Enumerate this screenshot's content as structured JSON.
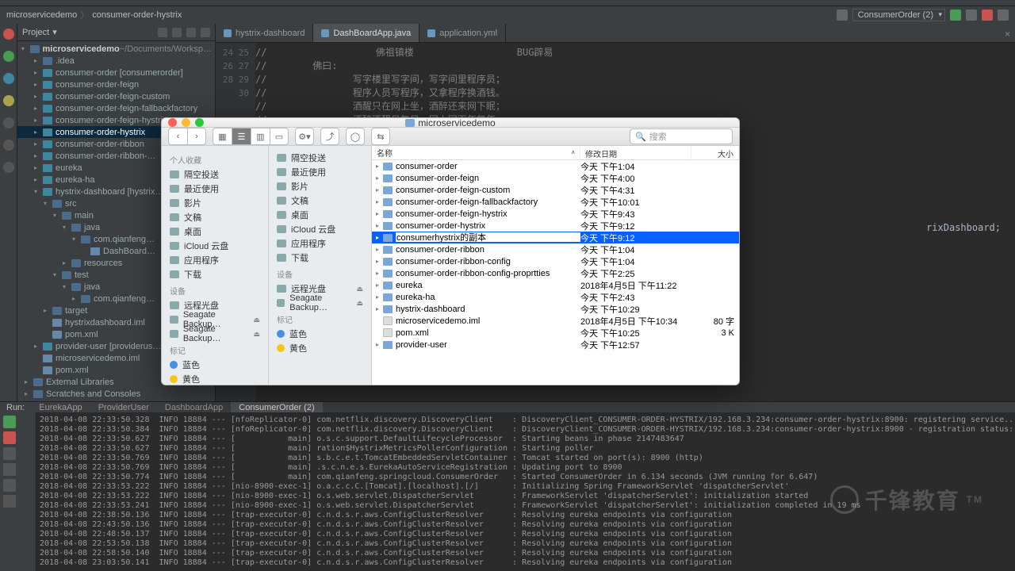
{
  "breadcrumb": {
    "a": "microservicedemo",
    "b": "consumer-order-hystrix"
  },
  "run_config": "ConsumerOrder (2)",
  "project": {
    "title": "Project",
    "root": "microservicedemo",
    "root_hint": "~/Documents/Worksp…",
    "items": [
      {
        "depth": 1,
        "arrow": "▸",
        "icon": "folder",
        "label": ".idea"
      },
      {
        "depth": 1,
        "arrow": "▸",
        "icon": "module",
        "label": "consumer-order [consumerorder]"
      },
      {
        "depth": 1,
        "arrow": "▸",
        "icon": "module",
        "label": "consumer-order-feign"
      },
      {
        "depth": 1,
        "arrow": "▸",
        "icon": "module",
        "label": "consumer-order-feign-custom"
      },
      {
        "depth": 1,
        "arrow": "▸",
        "icon": "module",
        "label": "consumer-order-feign-fallbackfactory"
      },
      {
        "depth": 1,
        "arrow": "▸",
        "icon": "module",
        "label": "consumer-order-feign-hystrix"
      },
      {
        "depth": 1,
        "arrow": "▸",
        "icon": "module",
        "label": "consumer-order-hystrix",
        "sel": true
      },
      {
        "depth": 1,
        "arrow": "▸",
        "icon": "module",
        "label": "consumer-order-ribbon"
      },
      {
        "depth": 1,
        "arrow": "▸",
        "icon": "module",
        "label": "consumer-order-ribbon-…"
      },
      {
        "depth": 1,
        "arrow": "▸",
        "icon": "module",
        "label": "eureka"
      },
      {
        "depth": 1,
        "arrow": "▸",
        "icon": "module",
        "label": "eureka-ha"
      },
      {
        "depth": 1,
        "arrow": "▾",
        "icon": "module",
        "label": "hystrix-dashboard [hystrix…"
      },
      {
        "depth": 2,
        "arrow": "▾",
        "icon": "folder",
        "label": "src"
      },
      {
        "depth": 3,
        "arrow": "▾",
        "icon": "folder",
        "label": "main"
      },
      {
        "depth": 4,
        "arrow": "▾",
        "icon": "folder",
        "label": "java"
      },
      {
        "depth": 5,
        "arrow": "▾",
        "icon": "folder",
        "label": "com.qianfeng…"
      },
      {
        "depth": 6,
        "arrow": " ",
        "icon": "file",
        "label": "DashBoard…"
      },
      {
        "depth": 4,
        "arrow": "▸",
        "icon": "folder",
        "label": "resources"
      },
      {
        "depth": 3,
        "arrow": "▾",
        "icon": "folder",
        "label": "test"
      },
      {
        "depth": 4,
        "arrow": "▾",
        "icon": "folder",
        "label": "java"
      },
      {
        "depth": 5,
        "arrow": "▸",
        "icon": "folder",
        "label": "com.qianfeng…"
      },
      {
        "depth": 2,
        "arrow": "▸",
        "icon": "folder",
        "label": "target"
      },
      {
        "depth": 2,
        "arrow": " ",
        "icon": "file",
        "label": "hystrixdashboard.iml"
      },
      {
        "depth": 2,
        "arrow": " ",
        "icon": "file",
        "label": "pom.xml"
      },
      {
        "depth": 1,
        "arrow": "▸",
        "icon": "module",
        "label": "provider-user [providerus…"
      },
      {
        "depth": 1,
        "arrow": " ",
        "icon": "file",
        "label": "microservicedemo.iml"
      },
      {
        "depth": 1,
        "arrow": " ",
        "icon": "file",
        "label": "pom.xml"
      },
      {
        "depth": 0,
        "arrow": "▸",
        "icon": "folder",
        "label": "External Libraries"
      },
      {
        "depth": 0,
        "arrow": "▸",
        "icon": "folder",
        "label": "Scratches and Consoles"
      }
    ]
  },
  "tabs": [
    {
      "label": "hystrix-dashboard"
    },
    {
      "label": "DashBoardApp.java",
      "active": true
    },
    {
      "label": "application.yml"
    }
  ],
  "gutter_start": 24,
  "code_lines": [
    "//                   佛祖镇楼                  BUG辟易",
    "//        佛曰:",
    "//               写字楼里写字间，写字间里程序员；",
    "//               程序人员写程序，又拿程序换酒钱。",
    "//               酒醒只在网上坐，酒醉还来网下眠；",
    "//               酒醉酒醒日复日，网上网下年复年。",
    "//"
  ],
  "import_fragment": "rixDashboard;",
  "run": {
    "label": "Run:",
    "tabs": [
      "EurekaApp",
      "ProviderUser",
      "DashboardApp",
      "ConsumerOrder (2)"
    ],
    "active_tab": 3,
    "lines": [
      "2018-04-08 22:33:50.328  INFO 18884 --- [nfoReplicator-0] com.netflix.discovery.DiscoveryClient    : DiscoveryClient_CONSUMER-ORDER-HYSTRIX/192.168.3.234:consumer-order-hystrix:8900: registering service...",
      "2018-04-08 22:33:50.384  INFO 18884 --- [nfoReplicator-0] com.netflix.discovery.DiscoveryClient    : DiscoveryClient_CONSUMER-ORDER-HYSTRIX/192.168.3.234:consumer-order-hystrix:8900 - registration status: 204",
      "2018-04-08 22:33:50.627  INFO 18884 --- [           main] o.s.c.support.DefaultLifecycleProcessor  : Starting beans in phase 2147483647",
      "2018-04-08 22:33:50.627  INFO 18884 --- [           main] ration$HystrixMetricsPollerConfiguration : Starting poller",
      "2018-04-08 22:33:50.769  INFO 18884 --- [           main] s.b.c.e.t.TomcatEmbeddedServletContainer : Tomcat started on port(s): 8900 (http)",
      "2018-04-08 22:33:50.769  INFO 18884 --- [           main] .s.c.n.e.s.EurekaAutoServiceRegistration : Updating port to 8900",
      "2018-04-08 22:33:50.774  INFO 18884 --- [           main] com.qianfeng.springcloud.ConsumerOrder   : Started ConsumerOrder in 6.134 seconds (JVM running for 6.647)",
      "2018-04-08 22:33:53.222  INFO 18884 --- [nio-8900-exec-1] o.a.c.c.C.[Tomcat].[localhost].[/]       : Initializing Spring FrameworkServlet 'dispatcherServlet'",
      "2018-04-08 22:33:53.222  INFO 18884 --- [nio-8900-exec-1] o.s.web.servlet.DispatcherServlet        : FrameworkServlet 'dispatcherServlet': initialization started",
      "2018-04-08 22:33:53.241  INFO 18884 --- [nio-8900-exec-1] o.s.web.servlet.DispatcherServlet        : FrameworkServlet 'dispatcherServlet': initialization completed in 19 ms",
      "2018-04-08 22:38:50.136  INFO 18884 --- [trap-executor-0] c.n.d.s.r.aws.ConfigClusterResolver      : Resolving eureka endpoints via configuration",
      "2018-04-08 22:43:50.136  INFO 18884 --- [trap-executor-0] c.n.d.s.r.aws.ConfigClusterResolver      : Resolving eureka endpoints via configuration",
      "2018-04-08 22:48:50.137  INFO 18884 --- [trap-executor-0] c.n.d.s.r.aws.ConfigClusterResolver      : Resolving eureka endpoints via configuration",
      "2018-04-08 22:53:50.138  INFO 18884 --- [trap-executor-0] c.n.d.s.r.aws.ConfigClusterResolver      : Resolving eureka endpoints via configuration",
      "2018-04-08 22:58:50.140  INFO 18884 --- [trap-executor-0] c.n.d.s.r.aws.ConfigClusterResolver      : Resolving eureka endpoints via configuration",
      "2018-04-08 23:03:50.141  INFO 18884 --- [trap-executor-0] c.n.d.s.r.aws.ConfigClusterResolver      : Resolving eureka endpoints via configuration"
    ]
  },
  "finder": {
    "title": "microservicedemo",
    "search_placeholder": "搜索",
    "sidebar": {
      "fav": "个人收藏",
      "fav_items": [
        "隔空投送",
        "最近使用",
        "影片",
        "文稿",
        "桌面",
        "iCloud 云盘",
        "应用程序",
        "下载"
      ],
      "devices": "设备",
      "dev_items": [
        {
          "label": "远程光盘"
        },
        {
          "label": "Seagate Backup…",
          "eject": true
        },
        {
          "label": "Seagate Backup…",
          "eject": true
        }
      ],
      "tags": "标记",
      "tag_items": [
        {
          "label": "蓝色",
          "color": "#4a90e2"
        },
        {
          "label": "黄色",
          "color": "#f5c518"
        }
      ]
    },
    "sidebar2": {
      "fav_items": [
        "隔空投送",
        "最近使用",
        "影片",
        "文稿",
        "桌面",
        "iCloud 云盘",
        "应用程序",
        "下载"
      ],
      "devices_items": [
        "远程光盘",
        "Seagate Backup…"
      ],
      "tag_items": [
        {
          "label": "蓝色",
          "color": "#4a90e2"
        },
        {
          "label": "黄色",
          "color": "#f5c518"
        }
      ]
    },
    "columns": {
      "name": "名称",
      "date": "修改日期",
      "size": "大小"
    },
    "rows": [
      {
        "type": "folder",
        "name": "consumer-order",
        "date": "今天 下午1:04",
        "size": ""
      },
      {
        "type": "folder",
        "name": "consumer-order-feign",
        "date": "今天 下午4:00",
        "size": ""
      },
      {
        "type": "folder",
        "name": "consumer-order-feign-custom",
        "date": "今天 下午4:31",
        "size": ""
      },
      {
        "type": "folder",
        "name": "consumer-order-feign-fallbackfactory",
        "date": "今天 下午10:01",
        "size": ""
      },
      {
        "type": "folder",
        "name": "consumer-order-feign-hystrix",
        "date": "今天 下午9:43",
        "size": ""
      },
      {
        "type": "folder",
        "name": "consumer-order-hystrix",
        "date": "今天 下午9:12",
        "size": ""
      },
      {
        "type": "folder",
        "name": "consumerhystrix的副本",
        "date": "今天 下午9:12",
        "size": "",
        "selected": true,
        "editing": true
      },
      {
        "type": "folder",
        "name": "consumer-order-ribbon",
        "date": "今天 下午1:04",
        "size": ""
      },
      {
        "type": "folder",
        "name": "consumer-order-ribbon-config",
        "date": "今天 下午1:04",
        "size": ""
      },
      {
        "type": "folder",
        "name": "consumer-order-ribbon-config-proprtties",
        "date": "今天 下午2:25",
        "size": ""
      },
      {
        "type": "folder",
        "name": "eureka",
        "date": "2018年4月5日 下午11:22",
        "size": ""
      },
      {
        "type": "folder",
        "name": "eureka-ha",
        "date": "今天 下午2:43",
        "size": ""
      },
      {
        "type": "folder",
        "name": "hystrix-dashboard",
        "date": "今天 下午10:29",
        "size": ""
      },
      {
        "type": "file",
        "name": "microservicedemo.iml",
        "date": "2018年4月5日 下午10:34",
        "size": "80 字"
      },
      {
        "type": "file",
        "name": "pom.xml",
        "date": "今天 下午10:25",
        "size": "3 K"
      },
      {
        "type": "folder",
        "name": "provider-user",
        "date": "今天 下午12:57",
        "size": ""
      }
    ]
  },
  "watermark": "千锋教育"
}
